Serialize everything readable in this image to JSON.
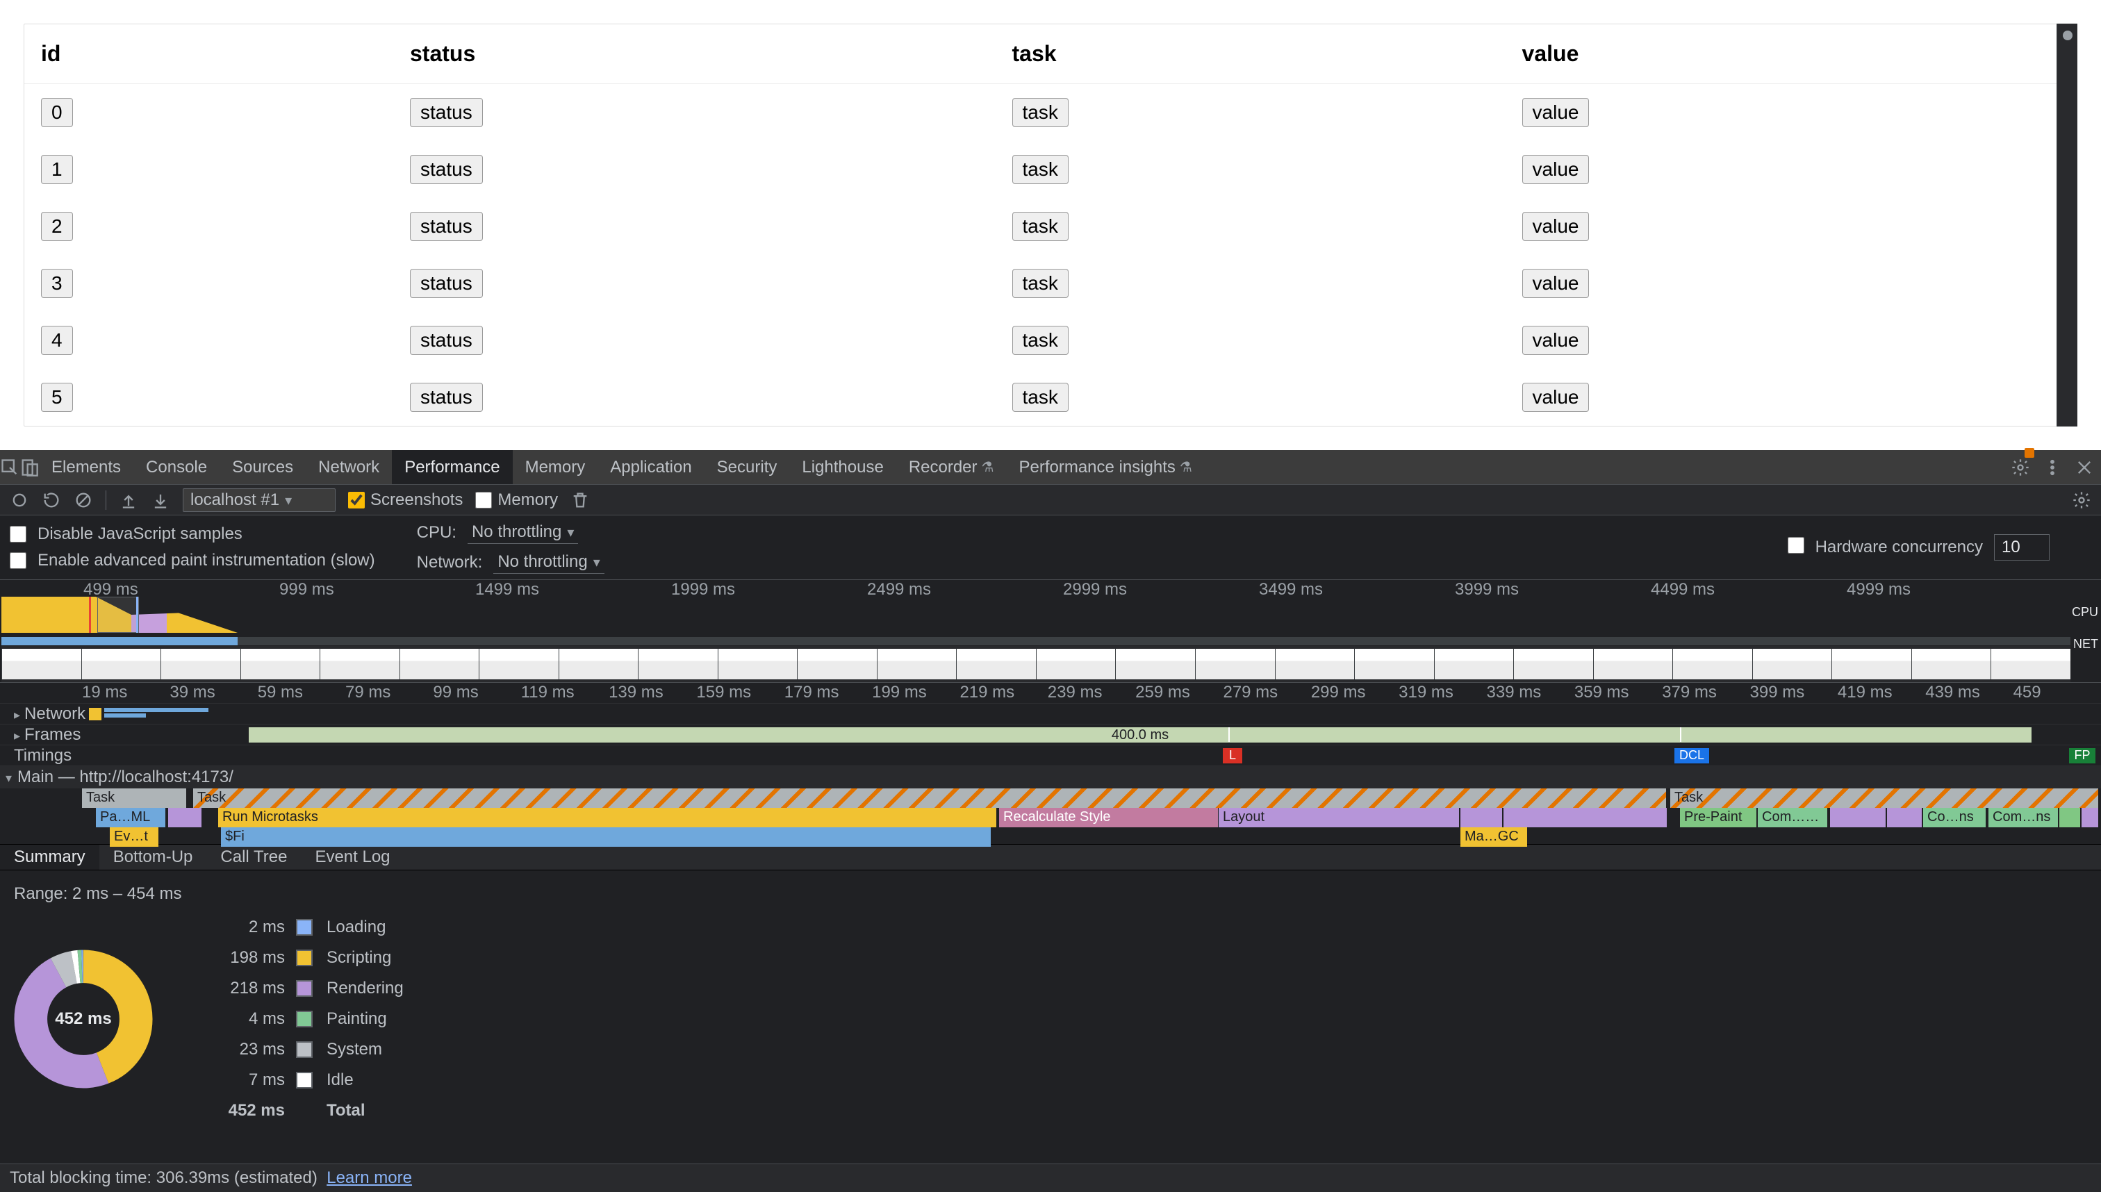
{
  "page": {
    "headers": [
      "id",
      "status",
      "task",
      "value"
    ],
    "rows": [
      {
        "id": "0",
        "status": "status",
        "task": "task",
        "value": "value"
      },
      {
        "id": "1",
        "status": "status",
        "task": "task",
        "value": "value"
      },
      {
        "id": "2",
        "status": "status",
        "task": "task",
        "value": "value"
      },
      {
        "id": "3",
        "status": "status",
        "task": "task",
        "value": "value"
      },
      {
        "id": "4",
        "status": "status",
        "task": "task",
        "value": "value"
      },
      {
        "id": "5",
        "status": "status",
        "task": "task",
        "value": "value"
      }
    ]
  },
  "devtools": {
    "tabs": {
      "elements": "Elements",
      "console": "Console",
      "sources": "Sources",
      "network": "Network",
      "performance": "Performance",
      "memory": "Memory",
      "application": "Application",
      "security": "Security",
      "lighthouse": "Lighthouse",
      "recorder": "Recorder",
      "perf_insights": "Performance insights"
    },
    "perf_toolbar": {
      "profile_selector": "localhost #1",
      "screenshots_label": "Screenshots",
      "memory_label": "Memory"
    },
    "settings": {
      "disable_js": "Disable JavaScript samples",
      "enable_paint": "Enable advanced paint instrumentation (slow)",
      "cpu_label": "CPU:",
      "cpu_value": "No throttling",
      "network_label": "Network:",
      "network_value": "No throttling",
      "hw_label": "Hardware concurrency",
      "hw_value": "10"
    },
    "overview": {
      "ruler": [
        "499 ms",
        "999 ms",
        "1499 ms",
        "1999 ms",
        "2499 ms",
        "2999 ms",
        "3499 ms",
        "3999 ms",
        "4499 ms",
        "4999 ms"
      ],
      "cpu_label": "CPU",
      "net_label": "NET"
    },
    "tracks": {
      "ruler": [
        "19 ms",
        "39 ms",
        "59 ms",
        "79 ms",
        "99 ms",
        "119 ms",
        "139 ms",
        "159 ms",
        "179 ms",
        "199 ms",
        "219 ms",
        "239 ms",
        "259 ms",
        "279 ms",
        "299 ms",
        "319 ms",
        "339 ms",
        "359 ms",
        "379 ms",
        "399 ms",
        "419 ms",
        "439 ms",
        "459"
      ],
      "network_label": "Network",
      "frames_label": "Frames",
      "frames_block": "400.0 ms",
      "timings_label": "Timings",
      "timings_l": "L",
      "timings_dcl": "DCL",
      "timings_fp": "FP",
      "main_label": "Main — http://localhost:4173/"
    },
    "flame": {
      "task1": "Task",
      "task2": "Task",
      "task3": "Task",
      "micro": "Run Microtasks",
      "recalc": "Recalculate Style",
      "layout": "Layout",
      "prepaint": "Pre-Paint",
      "commit1": "Com…ons",
      "commit2": "Co…ns",
      "commit3": "Com…ns",
      "pahtml": "Pa…ML",
      "evt": "Ev…t",
      "fi": "$Fi",
      "gc": "Ma…GC"
    },
    "details_tabs": {
      "summary": "Summary",
      "bottom_up": "Bottom-Up",
      "call_tree": "Call Tree",
      "event_log": "Event Log"
    },
    "summary": {
      "range": "Range: 2 ms – 454 ms",
      "donut_center": "452 ms",
      "legend": {
        "loading_t": "2 ms",
        "loading_l": "Loading",
        "scripting_t": "198 ms",
        "scripting_l": "Scripting",
        "rendering_t": "218 ms",
        "rendering_l": "Rendering",
        "painting_t": "4 ms",
        "painting_l": "Painting",
        "system_t": "23 ms",
        "system_l": "System",
        "idle_t": "7 ms",
        "idle_l": "Idle",
        "total_t": "452 ms",
        "total_l": "Total"
      }
    },
    "tbt": {
      "text": "Total blocking time: 306.39ms (estimated)",
      "link": "Learn more"
    }
  }
}
